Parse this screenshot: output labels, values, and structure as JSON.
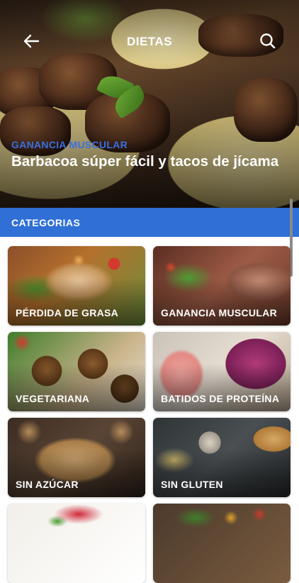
{
  "header": {
    "title": "DIETAS",
    "back_icon": "arrow-left-icon",
    "search_icon": "search-icon"
  },
  "featured": {
    "category": "GANANCIA MUSCULAR",
    "title": "Barbacoa súper fácil y tacos de jícama"
  },
  "categories": {
    "heading": "CATEGORIAS",
    "items": [
      {
        "label": "PÉRDIDA DE GRASA"
      },
      {
        "label": "GANANCIA MUSCULAR"
      },
      {
        "label": "VEGETARIANA"
      },
      {
        "label": "BATIDOS DE PROTEÍNA"
      },
      {
        "label": "SIN AZÚCAR"
      },
      {
        "label": "SIN GLUTEN"
      },
      {
        "label": ""
      },
      {
        "label": ""
      }
    ]
  },
  "colors": {
    "accent": "#2f6fd6",
    "featured_category": "#3b6fe0"
  }
}
